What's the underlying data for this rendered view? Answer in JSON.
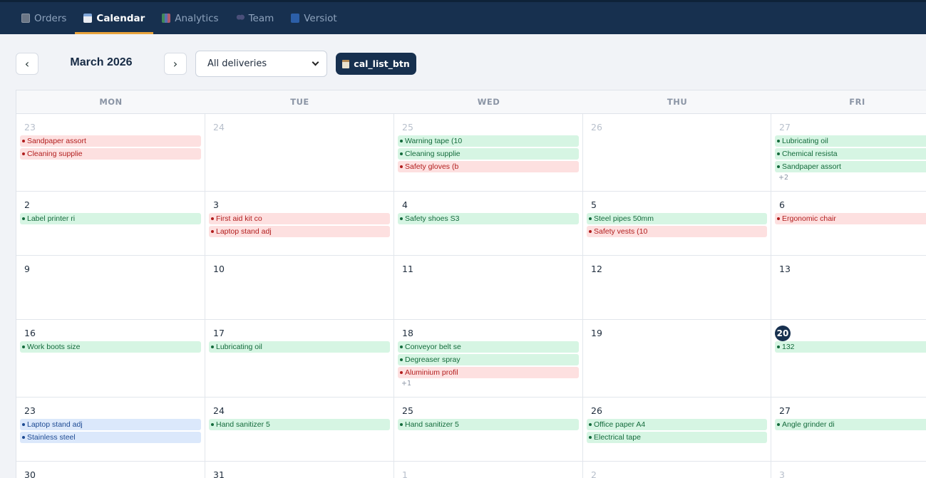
{
  "nav": {
    "tabs": [
      {
        "label": "Orders",
        "icon": "orders-icon",
        "active": false
      },
      {
        "label": "Calendar",
        "icon": "calendar-icon",
        "active": true
      },
      {
        "label": "Analytics",
        "icon": "analytics-icon",
        "active": false
      },
      {
        "label": "Team",
        "icon": "team-icon",
        "active": false
      },
      {
        "label": "Versiot",
        "icon": "new-badge-icon",
        "active": false
      }
    ]
  },
  "toolbar": {
    "prev": "‹",
    "next": "›",
    "month": "March 2026",
    "filter_value": "All deliveries",
    "list_button": "cal_list_btn"
  },
  "calendar": {
    "days": [
      "MON",
      "TUE",
      "WED",
      "THU",
      "FRI"
    ],
    "weeks": [
      [
        {
          "day": "23",
          "muted": true,
          "events": [
            {
              "t": "Sandpaper assort",
              "c": "r"
            },
            {
              "t": "Cleaning supplie",
              "c": "r"
            }
          ]
        },
        {
          "day": "24",
          "muted": true,
          "events": []
        },
        {
          "day": "25",
          "muted": true,
          "events": [
            {
              "t": "Warning tape (10",
              "c": "g"
            },
            {
              "t": "Cleaning supplie",
              "c": "g"
            },
            {
              "t": "Safety gloves (b",
              "c": "r"
            }
          ]
        },
        {
          "day": "26",
          "muted": true,
          "events": []
        },
        {
          "day": "27",
          "muted": true,
          "events": [
            {
              "t": "Lubricating oil",
              "c": "g"
            },
            {
              "t": "Chemical resista",
              "c": "g"
            },
            {
              "t": "Sandpaper assort",
              "c": "g"
            }
          ],
          "more": "+2"
        }
      ],
      [
        {
          "day": "2",
          "events": [
            {
              "t": "Label printer ri",
              "c": "g"
            }
          ]
        },
        {
          "day": "3",
          "events": [
            {
              "t": "First aid kit co",
              "c": "r"
            },
            {
              "t": "Laptop stand adj",
              "c": "r"
            }
          ]
        },
        {
          "day": "4",
          "events": [
            {
              "t": "Safety shoes S3",
              "c": "g"
            }
          ]
        },
        {
          "day": "5",
          "events": [
            {
              "t": "Steel pipes 50mm",
              "c": "g"
            },
            {
              "t": "Safety vests (10",
              "c": "r"
            }
          ]
        },
        {
          "day": "6",
          "events": [
            {
              "t": "Ergonomic chair",
              "c": "r"
            }
          ]
        }
      ],
      [
        {
          "day": "9",
          "events": []
        },
        {
          "day": "10",
          "events": []
        },
        {
          "day": "11",
          "events": []
        },
        {
          "day": "12",
          "events": []
        },
        {
          "day": "13",
          "events": []
        }
      ],
      [
        {
          "day": "16",
          "events": [
            {
              "t": "Work boots size",
              "c": "g"
            }
          ]
        },
        {
          "day": "17",
          "events": [
            {
              "t": "Lubricating oil",
              "c": "g"
            }
          ]
        },
        {
          "day": "18",
          "events": [
            {
              "t": "Conveyor belt se",
              "c": "g"
            },
            {
              "t": "Degreaser spray",
              "c": "g"
            },
            {
              "t": "Aluminium profil",
              "c": "r"
            }
          ],
          "more": "+1"
        },
        {
          "day": "19",
          "events": []
        },
        {
          "day": "20",
          "today": true,
          "events": [
            {
              "t": "132",
              "c": "g"
            }
          ]
        }
      ],
      [
        {
          "day": "23",
          "events": [
            {
              "t": "Laptop stand adj",
              "c": "b"
            },
            {
              "t": "Stainless steel",
              "c": "b"
            }
          ]
        },
        {
          "day": "24",
          "events": [
            {
              "t": "Hand sanitizer 5",
              "c": "g"
            }
          ]
        },
        {
          "day": "25",
          "events": [
            {
              "t": "Hand sanitizer 5",
              "c": "g"
            }
          ]
        },
        {
          "day": "26",
          "events": [
            {
              "t": "Office paper A4",
              "c": "g"
            },
            {
              "t": "Electrical tape",
              "c": "g"
            }
          ]
        },
        {
          "day": "27",
          "events": [
            {
              "t": "Angle grinder di",
              "c": "g"
            }
          ]
        }
      ],
      [
        {
          "day": "30",
          "events": []
        },
        {
          "day": "31",
          "events": []
        },
        {
          "day": "1",
          "muted": true,
          "events": []
        },
        {
          "day": "2",
          "muted": true,
          "events": []
        },
        {
          "day": "3",
          "muted": true,
          "events": []
        }
      ]
    ]
  }
}
